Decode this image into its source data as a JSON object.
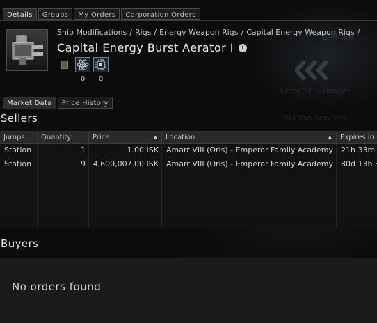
{
  "top_tabs": [
    "Details",
    "Groups",
    "My Orders",
    "Corporation Orders"
  ],
  "item": {
    "breadcrumb": [
      "Ship Modifications",
      "Rigs",
      "Energy Weapon Rigs",
      "Capital Energy Weapon Rigs"
    ],
    "title": "Capital Energy Burst Aerator I",
    "info_icon": "i",
    "skill_counts": [
      "0",
      "0"
    ]
  },
  "market_tabs": [
    "Market Data",
    "Price History"
  ],
  "sellers": {
    "title": "Sellers",
    "columns": [
      "Jumps",
      "Quantity",
      "Price",
      "Location",
      "Expires in"
    ],
    "rows": [
      {
        "jumps": "Station",
        "quantity": "1",
        "price": "1.00 ISK",
        "location": "Amarr VIII (Oris) - Emperor Family Academy",
        "expires": "21h 33m"
      },
      {
        "jumps": "Station",
        "quantity": "9",
        "price": "4,600,007.00 ISK",
        "location": "Amarr VIII (Oris) - Emperor Family Academy",
        "expires": "80d 13h 3"
      }
    ]
  },
  "buyers": {
    "title": "Buyers",
    "empty_text": "No orders found"
  },
  "background_text": [
    "EMP LR",
    "Enter Ship Hangar",
    "Station Services"
  ],
  "colors": {
    "accent": "#6b7f92",
    "background": "#0c0c0c"
  }
}
